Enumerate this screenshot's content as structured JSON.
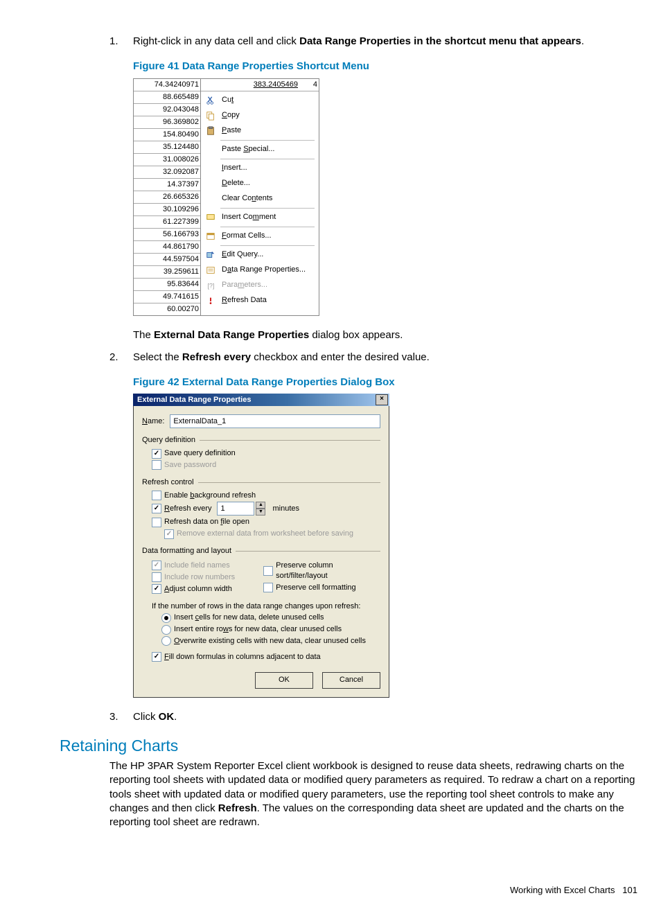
{
  "steps": {
    "s1a": "Right-click in any data cell and click ",
    "s1b": "Data Range Properties in the shortcut menu that appears",
    "s1c": ".",
    "s1d_a": "The ",
    "s1d_b": "External Data Range Properties",
    "s1d_c": " dialog box appears.",
    "s2a": "Select the ",
    "s2b": "Refresh every",
    "s2c": " checkbox and enter the desired value.",
    "s3a": "Click ",
    "s3b": "OK",
    "s3c": "."
  },
  "fig41": {
    "caption": "Figure 41 Data Range Properties Shortcut Menu",
    "colA": [
      "74.34240971",
      "88.665489",
      "92.043048",
      "96.369802",
      "154.80490",
      "35.124480",
      "31.008026",
      "32.092087",
      "14.37397",
      "26.665326",
      "30.109296",
      "61.227399",
      "56.166793",
      "44.861790",
      "44.597504",
      "39.259611",
      "95.83644",
      "49.741615",
      "60.00270"
    ],
    "topB": "383.2405469",
    "topB2": "4",
    "menu": {
      "cut_pre": "Cu",
      "cut_u": "t",
      "copy_u": "C",
      "copy_post": "opy",
      "paste_u": "P",
      "paste_post": "aste",
      "pspecial_pre": "Paste ",
      "pspecial_u": "S",
      "pspecial_post": "pecial...",
      "insert_u": "I",
      "insert_post": "nsert...",
      "delete_u": "D",
      "delete_post": "elete...",
      "clear_pre": "Clear Co",
      "clear_u": "n",
      "clear_post": "tents",
      "comment_pre": "Insert Co",
      "comment_u": "m",
      "comment_post": "ment",
      "fcells_u": "F",
      "fcells_post": "ormat Cells...",
      "equery_u": "E",
      "equery_post": "dit Query...",
      "drp_pre": "D",
      "drp_u": "a",
      "drp_post": "ta Range Properties...",
      "params_pre": "Para",
      "params_u": "m",
      "params_post": "eters...",
      "refresh_u": "R",
      "refresh_post": "efresh Data"
    }
  },
  "fig42": {
    "caption": "Figure 42 External Data Range Properties Dialog Box",
    "title": "External Data Range Properties",
    "name_u": "N",
    "name_post": "ame:",
    "name_value": "ExternalData_1",
    "grp_query": "Query definition",
    "save_query": "Save query definition",
    "save_pw": "Save password",
    "grp_refresh": "Refresh control",
    "bgrefresh_pre": "Enable ",
    "bgrefresh_u": "b",
    "bgrefresh_post": "ackground refresh",
    "revery_u": "R",
    "revery_post": "efresh every",
    "revery_value": "1",
    "minutes": "minutes",
    "ronopen_pre": "Refresh data on ",
    "ronopen_u": "f",
    "ronopen_post": "ile open",
    "remove_ext": "Remove external data from worksheet before saving",
    "grp_layout": "Data formatting and layout",
    "inc_field": "Include field names",
    "pres_sort": "Preserve column sort/filter/layout",
    "inc_row": "Include row numbers",
    "pres_cell": "Preserve cell formatting",
    "adj_u": "A",
    "adj_post": "djust column width",
    "ifrows": "If the number of rows in the data range changes upon refresh:",
    "r1_pre": "Insert ",
    "r1_u": "c",
    "r1_post": "ells for new data, delete unused cells",
    "r2_pre": "Insert entire ro",
    "r2_u": "w",
    "r2_post": "s for new data, clear unused cells",
    "r3_u": "O",
    "r3_post": "verwrite existing cells with new data, clear unused cells",
    "fill_u": "F",
    "fill_post": "ill down formulas in columns adjacent to data",
    "ok": "OK",
    "cancel": "Cancel"
  },
  "section": {
    "heading": "Retaining Charts",
    "p_a": "The HP 3PAR System Reporter Excel client workbook is designed to reuse data sheets, redrawing charts on the reporting tool sheets with updated data or modified query parameters as required. To redraw a chart on a reporting tools sheet with updated data or modified query parameters, use the reporting tool sheet controls to make any changes and then click ",
    "p_b": "Refresh",
    "p_c": ". The values on the corresponding data sheet are updated and the charts on the reporting tool sheet are redrawn."
  },
  "footer": {
    "text": "Working with Excel Charts",
    "page": "101"
  }
}
